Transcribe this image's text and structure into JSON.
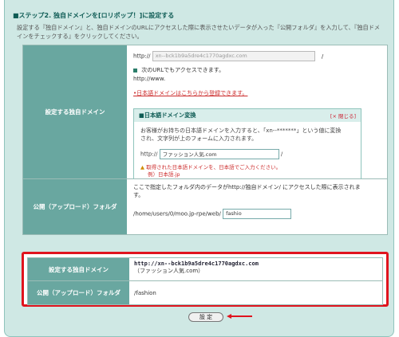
{
  "step": {
    "title": "■ステップ2. 独自ドメインを[ロリポップ！]に設定する",
    "desc_line1": "設定する『独自ドメイン』と、独自ドメインのURLにアクセスした際に表示させたいデータが入った『公開フォルダ』を入力して、『独自ドメ",
    "desc_line2": "インをチェックする』をクリックしてください。"
  },
  "domain_row": {
    "label": "設定する独自ドメイン",
    "prefix": "http://",
    "value": "xn--bck1b9a5dre4c1770agdxc.com",
    "suffix": "/",
    "www_note": "次のURLでもアクセスできます。",
    "www_url": "http://www.",
    "jp_register_link": "•日本語ドメインはこちらから登録できます。"
  },
  "jp_convert": {
    "title": "■日本語ドメイン変換",
    "close": "[× 閉じる]",
    "desc_line1": "お客様がお持ちの日本語ドメインを入力すると、「xn--*******」という値に変換",
    "desc_line2": "され、文字列が上のフォームに入力されます。",
    "prefix": "http://",
    "value": "ファッション人気.com",
    "suffix": "/",
    "warn_line1": "取得された日本語ドメインを、日本語でご入力ください。",
    "warn_line2": "例）日本語.jp"
  },
  "folder_row": {
    "label": "公開（アップロード）フォルダ",
    "desc_line1": "ここで指定したフォルダ内のデータがhttp://独自ドメイン/ にアクセスした際に表示されま",
    "desc_line2": "す。",
    "path": "/home/users/0/moo.jp-rpe/web/",
    "value": "fashio"
  },
  "summary": {
    "domain_label": "設定する独自ドメイン",
    "domain_value": "http://xn--bck1b9a5dre4c1770agdxc.com",
    "domain_jp": "（ファッション人気.com）",
    "folder_label": "公開（アップロード）フォルダ",
    "folder_value": "/fashion"
  },
  "button": {
    "label": "設 定"
  },
  "colors": {
    "highlight": "#e0141e",
    "label_bg": "#69a7a0",
    "panel_bg": "#cfe8e4"
  }
}
